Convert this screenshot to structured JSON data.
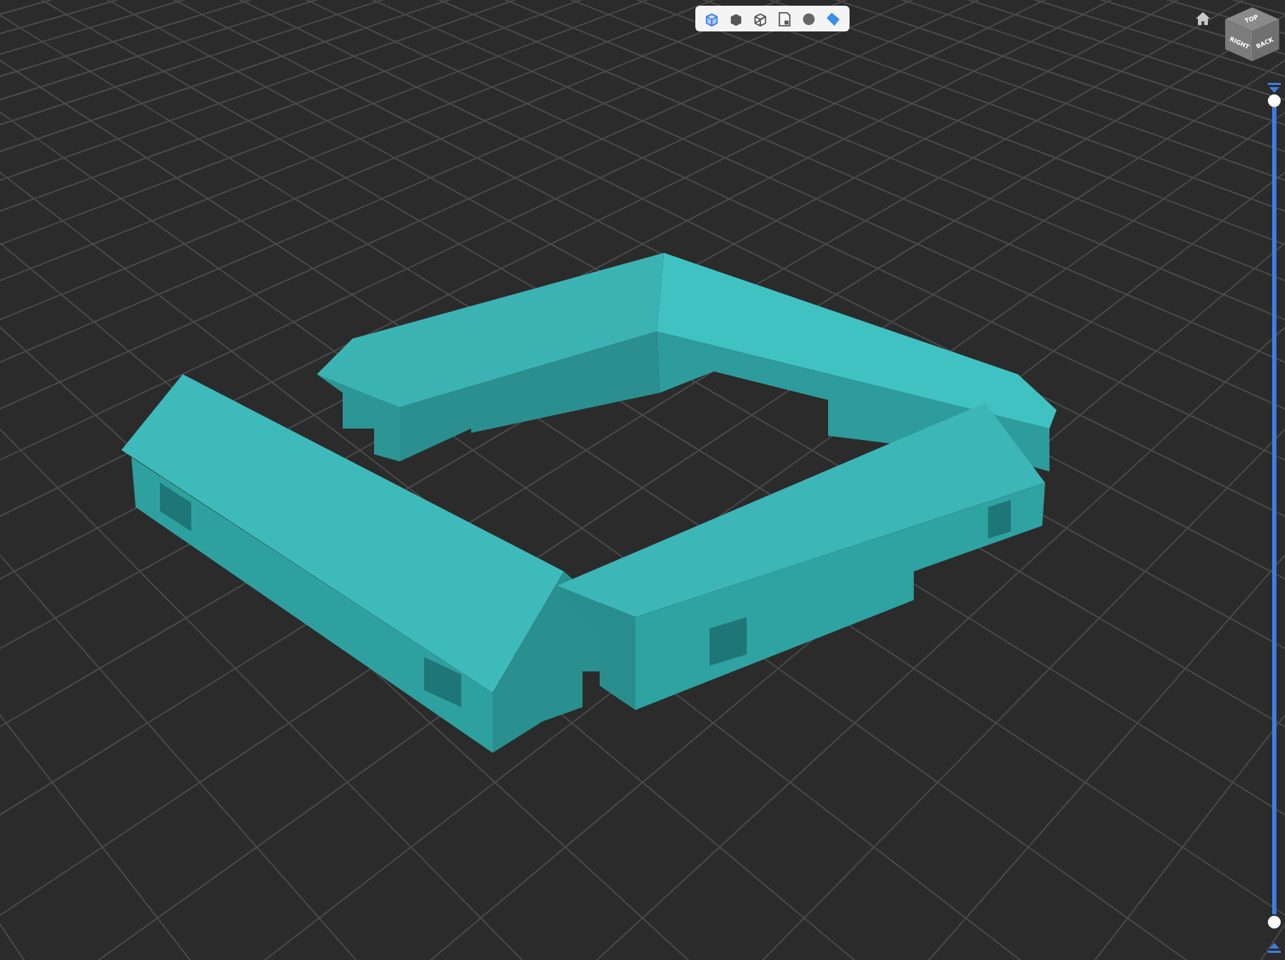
{
  "toolbar": {
    "items": [
      {
        "kind": "box",
        "selected": true
      },
      {
        "kind": "solid",
        "selected": false
      },
      {
        "kind": "wire",
        "selected": false
      },
      {
        "kind": "section",
        "selected": false
      },
      {
        "kind": "sphere",
        "selected": false
      },
      {
        "kind": "material",
        "selected": true
      }
    ]
  },
  "view_cube": {
    "faces": [
      {
        "kind": "top",
        "label": "TOP"
      },
      {
        "kind": "left",
        "label": "RIGHT"
      },
      {
        "kind": "right",
        "label": "BACK"
      }
    ]
  },
  "clip_slider": {
    "handles": [
      {
        "level": 1
      },
      {
        "level": 0
      }
    ]
  }
}
